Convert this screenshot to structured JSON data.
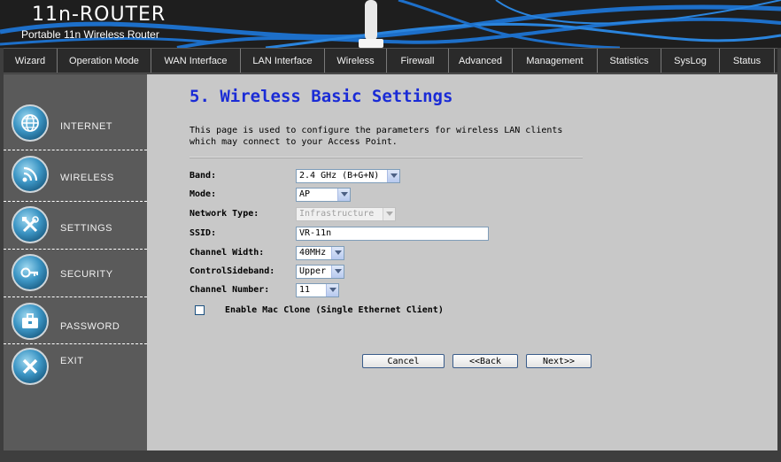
{
  "header": {
    "logo_title": "11n-ROUTER",
    "logo_subtitle": "Portable 11n Wireless Router"
  },
  "nav": {
    "items": [
      {
        "label": "Wizard"
      },
      {
        "label": "Operation Mode"
      },
      {
        "label": "WAN Interface"
      },
      {
        "label": "LAN Interface"
      },
      {
        "label": "Wireless"
      },
      {
        "label": "Firewall"
      },
      {
        "label": "Advanced"
      },
      {
        "label": "Management"
      },
      {
        "label": "Statistics"
      },
      {
        "label": "SysLog"
      },
      {
        "label": "Status"
      }
    ]
  },
  "sidebar": {
    "items": [
      {
        "label": "INTERNET",
        "icon": "globe-icon"
      },
      {
        "label": "WIRELESS",
        "icon": "wireless-icon"
      },
      {
        "label": "SETTINGS",
        "icon": "tools-icon"
      },
      {
        "label": "SECURITY",
        "icon": "key-icon"
      },
      {
        "label": "PASSWORD",
        "icon": "briefcase-icon"
      },
      {
        "label": "EXIT",
        "icon": "close-icon"
      }
    ]
  },
  "main": {
    "title": "5. Wireless Basic Settings",
    "description_line1": "This page is used to configure the parameters for wireless LAN clients",
    "description_line2": "which may connect to your Access Point.",
    "form": {
      "band_label": "Band:",
      "band_value": "2.4 GHz (B+G+N)",
      "mode_label": "Mode:",
      "mode_value": "AP",
      "network_type_label": "Network Type:",
      "network_type_value": "Infrastructure",
      "ssid_label": "SSID:",
      "ssid_value": "VR-11n",
      "channel_width_label": "Channel Width:",
      "channel_width_value": "40MHz",
      "control_sideband_label": "ControlSideband:",
      "control_sideband_value": "Upper",
      "channel_number_label": "Channel Number:",
      "channel_number_value": "11",
      "mac_clone_label": "Enable Mac Clone (Single Ethernet Client)",
      "mac_clone_checked": false
    },
    "buttons": {
      "cancel": "Cancel",
      "back": "<<Back",
      "next": "Next>>"
    }
  },
  "colors": {
    "title_blue": "#1a2bd6",
    "sidebar_bg": "#5a5a5a",
    "main_bg": "#c8c8c8",
    "header_bg": "#1e1e1e",
    "swoosh_blue": "#1d6fc9"
  }
}
